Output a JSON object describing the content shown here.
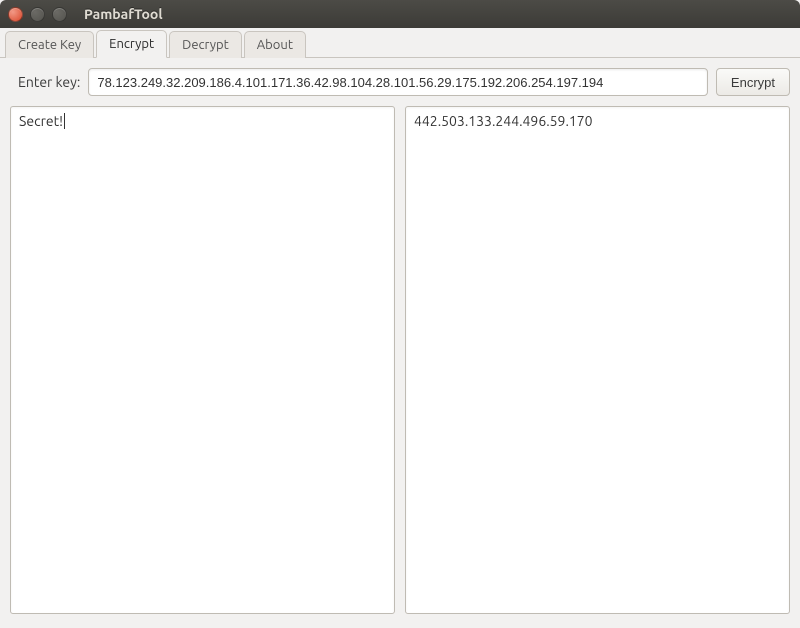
{
  "window": {
    "title": "PambafTool"
  },
  "tabs": [
    {
      "label": "Create Key",
      "active": false
    },
    {
      "label": "Encrypt",
      "active": true
    },
    {
      "label": "Decrypt",
      "active": false
    },
    {
      "label": "About",
      "active": false
    }
  ],
  "encrypt": {
    "key_label": "Enter key:",
    "key_value": "78.123.249.32.209.186.4.101.171.36.42.98.104.28.101.56.29.175.192.206.254.197.194",
    "button_label": "Encrypt",
    "input_text": "Secret!",
    "output_text": "442.503.133.244.496.59.170"
  }
}
